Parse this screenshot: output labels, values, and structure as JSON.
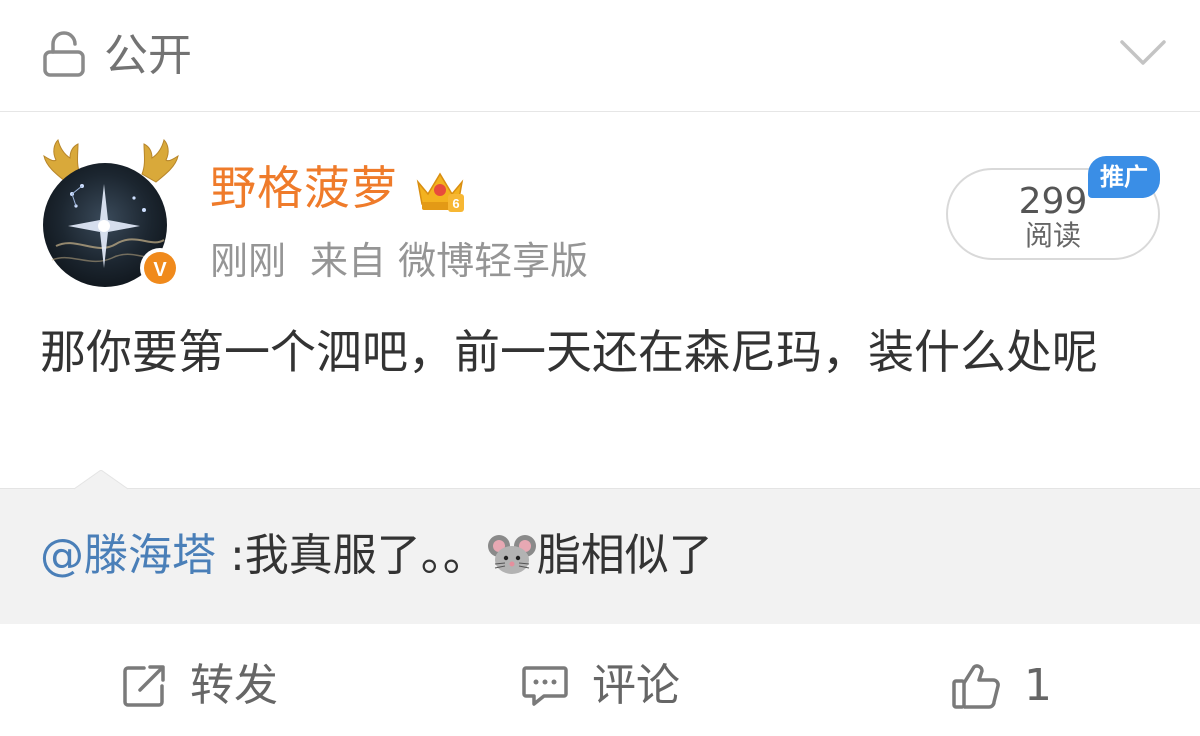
{
  "visibility": {
    "label": "公开",
    "lock_icon": "lock-icon",
    "expand_icon": "chevron-down-icon"
  },
  "author": {
    "name": "野格菠萝",
    "badge_icon": "crown-level-6-icon",
    "verified_mark": "V"
  },
  "meta": {
    "time": "刚刚",
    "source": "来自 微博轻享版"
  },
  "read_counter": {
    "count": "299",
    "label": "阅读",
    "promo_badge": "推广"
  },
  "post": {
    "text": "那你要第一个泗吧，前一天还在森尼玛，装什么处呢"
  },
  "quote": {
    "mention": "@滕海塔",
    "text_before_emoji": " :我真服了。。",
    "emoji": "mouse-face-emoji",
    "text_after_emoji": "脂相似了"
  },
  "actions": {
    "repost": {
      "label": "转发",
      "icon": "repost-icon"
    },
    "comment": {
      "label": "评论",
      "icon": "comment-icon"
    },
    "like": {
      "count": "1",
      "icon": "thumbs-up-icon"
    }
  },
  "colors": {
    "author_name": "#ef7b2a",
    "mention": "#4a7fb8",
    "promo": "#3a8ee6",
    "quote_bg": "#f2f2f2"
  }
}
